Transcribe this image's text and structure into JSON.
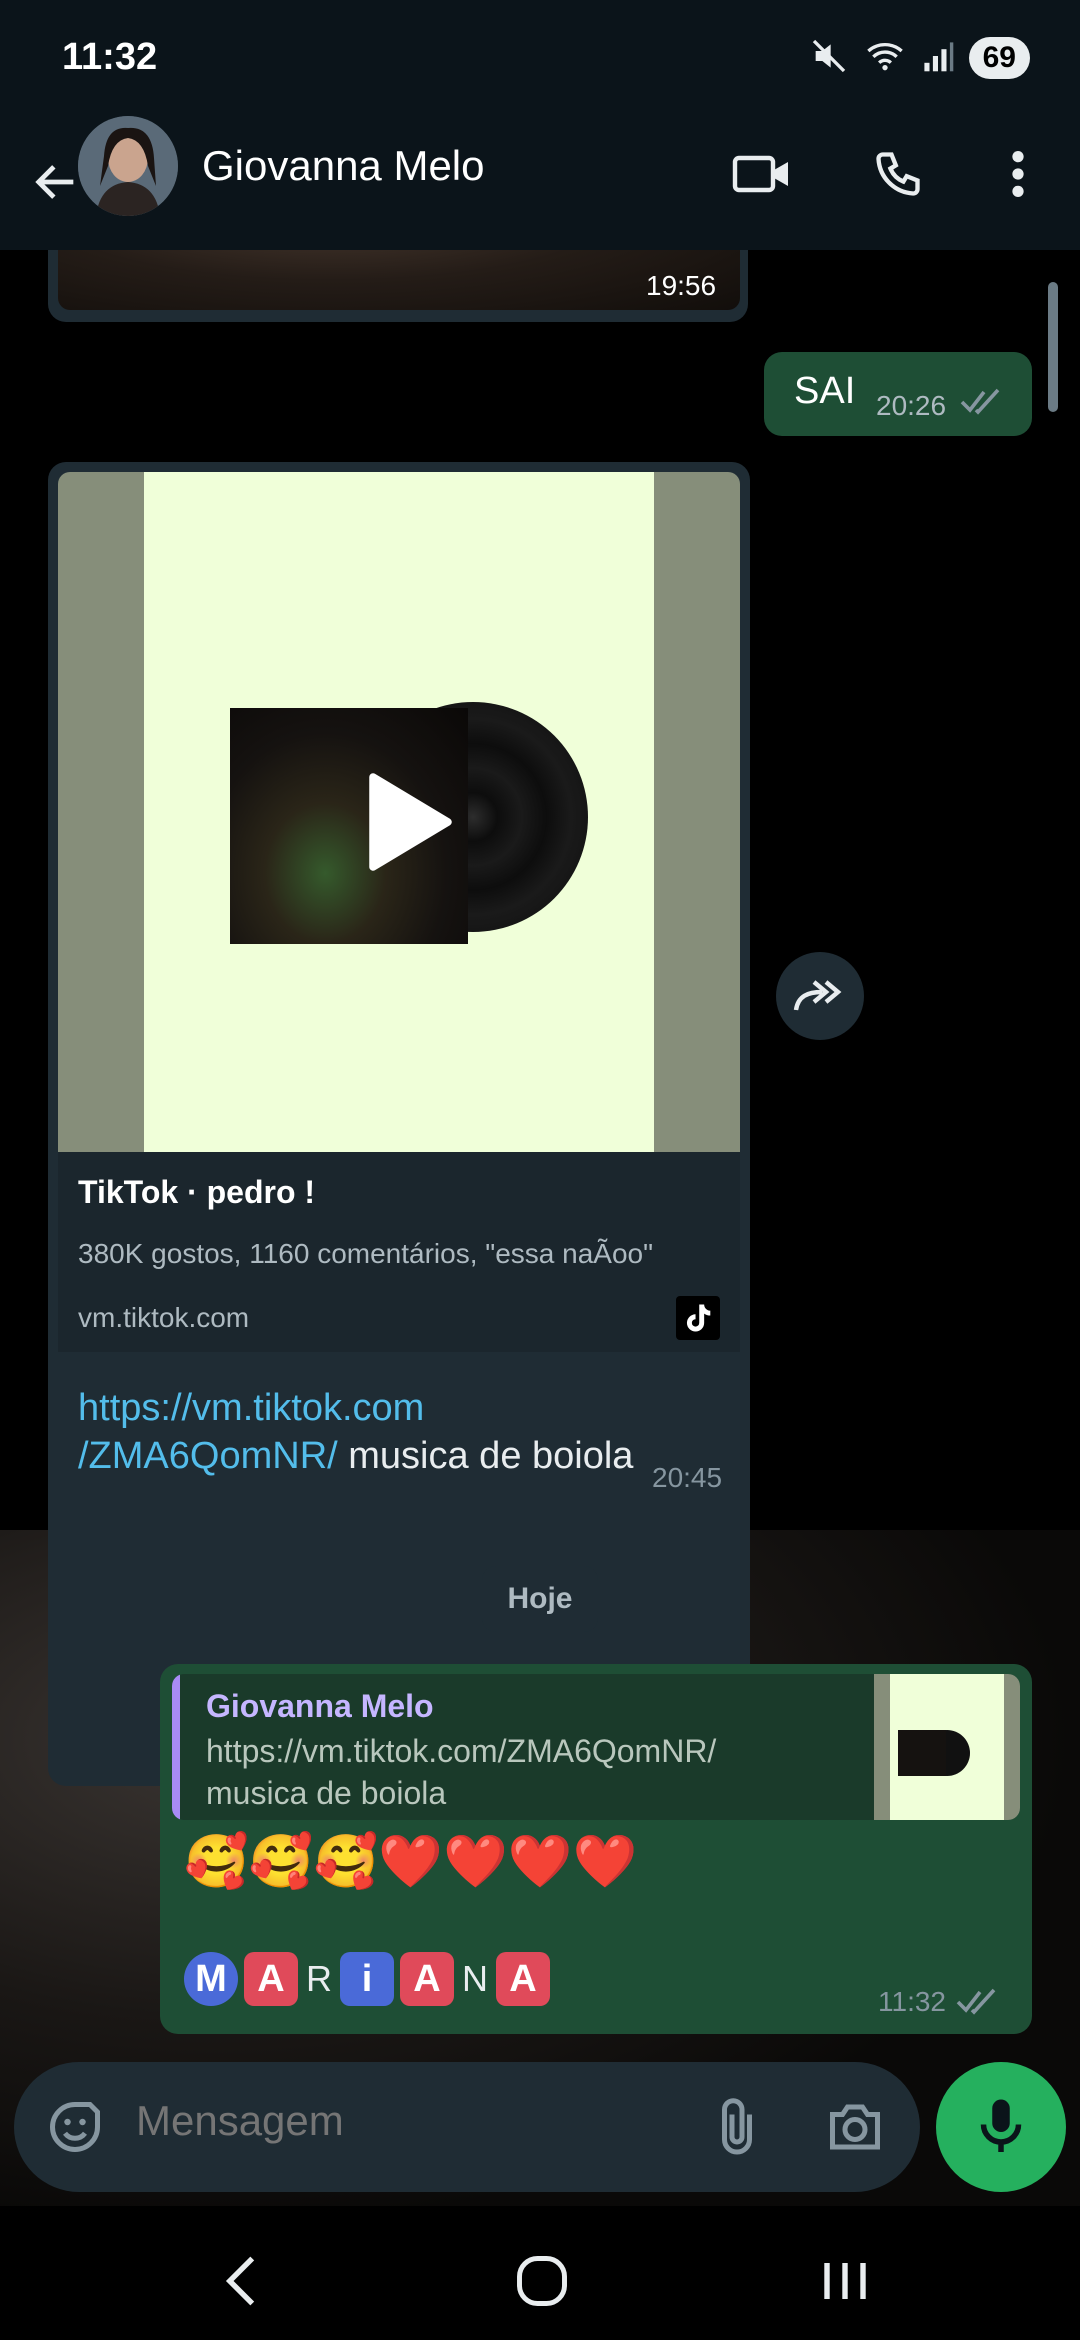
{
  "status": {
    "time": "11:32",
    "battery": "69"
  },
  "header": {
    "contact_name": "Giovanna Melo"
  },
  "messages": {
    "prev_media_time": "19:56",
    "sai": {
      "text": "SAI",
      "time": "20:26"
    },
    "tiktok": {
      "title": "TikTok · pedro !",
      "description": "380K gostos, 1160 comentários, \"essa naÃoo\"",
      "domain": "vm.tiktok.com",
      "link_line1": "https://vm.tiktok.com",
      "link_line2": "/ZMA6QomNR/",
      "caption": " musica de boiola",
      "time": "20:45"
    },
    "day_chip": "Hoje",
    "reply": {
      "quoted_name": "Giovanna Melo",
      "quoted_text_line1": "https://vm.tiktok.com/ZMA6QomNR/",
      "quoted_text_line2": "musica de boiola",
      "emojis": "🥰🥰🥰❤️❤️❤️❤️",
      "name_letters": [
        "M",
        "A",
        "R",
        "i",
        "A",
        "N",
        "A"
      ],
      "time": "11:32"
    }
  },
  "composer": {
    "placeholder": "Mensagem"
  },
  "colors": {
    "accent_green": "#25b05e",
    "outgoing_bubble": "#1e4e35",
    "incoming_bubble": "#1f2c34",
    "link_blue": "#53bdeb"
  }
}
